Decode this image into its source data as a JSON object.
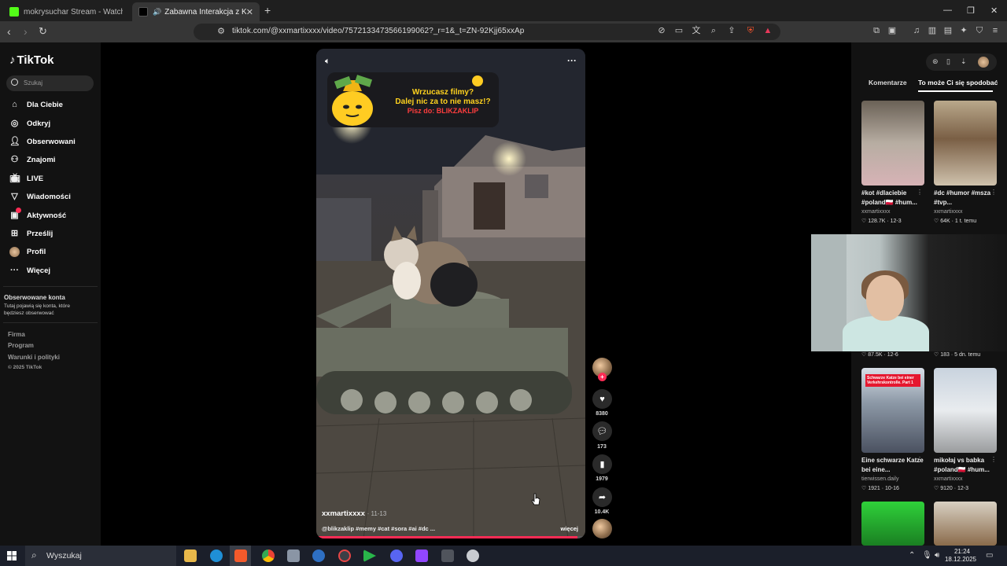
{
  "browser": {
    "tabs": [
      {
        "label": "mokrysuchar Stream - Watch Live on",
        "favicon_color": "#53fc18"
      },
      {
        "label": "Zabawna Interakcja z Kotem w",
        "favicon_color": "#000000"
      }
    ],
    "new_tab": "+",
    "url": "tiktok.com/@xxmartixxxx/video/7572133473566199062?_r=1&_t=ZN-92Kjj65xxAp"
  },
  "sidebar": {
    "logo": "TikTok",
    "search_placeholder": "Szukaj",
    "nav": [
      {
        "label": "Dla Ciebie",
        "icon": "home-icon"
      },
      {
        "label": "Odkryj",
        "icon": "compass-icon"
      },
      {
        "label": "Obserwowani",
        "icon": "following-icon"
      },
      {
        "label": "Znajomi",
        "icon": "friends-icon"
      },
      {
        "label": "LIVE",
        "icon": "live-icon"
      },
      {
        "label": "Wiadomości",
        "icon": "messages-icon"
      },
      {
        "label": "Aktywność",
        "icon": "activity-icon"
      },
      {
        "label": "Prześlij",
        "icon": "upload-icon"
      },
      {
        "label": "Profil",
        "icon": "profile-avatar"
      },
      {
        "label": "Więcej",
        "icon": "more-icon"
      }
    ],
    "following_heading": "Obserwowane konta",
    "following_text": "Tutaj pojawią się konta, które będziesz obserwować",
    "footer": [
      "Firma",
      "Program",
      "Warunki i polityki",
      "© 2025 TikTok"
    ]
  },
  "video": {
    "banner": {
      "line1": "Wrzucasz filmy?",
      "line2": "Dalej nic za to nie masz!?",
      "line3": "Pisz do: BLIKZAKLIP"
    },
    "author": "xxmartixxxx",
    "date": "· 11-13",
    "caption": "@blikzaklip #memy #cat #sora #ai #dc ...",
    "more": "więcej",
    "progress": 0.97
  },
  "actions": {
    "likes": "8380",
    "comments": "173",
    "saves": "1979",
    "shares": "10.4K"
  },
  "right_panel": {
    "tabs": [
      "Komentarze",
      "To może Ci się spodobać"
    ],
    "items": [
      {
        "title": "#kot #dlaciebie #poland🇵🇱 #hum...",
        "user": "xxmartixxxx",
        "stats": "♡ 128.7K · 12-3"
      },
      {
        "title": "#dc #humor #msza #tvp...",
        "user": "xxmartixxxx",
        "stats": "♡ 64K · 1 t. temu"
      },
      {
        "stats": "♡ 87.5K · 12-6"
      },
      {
        "stats": "♡ 183 · 5 dn. temu"
      },
      {
        "title": "Eine schwarze Katze bei eine...",
        "user": "tierwissen.daily",
        "stats": "♡ 1921 · 10-16",
        "overlay": "Schwarze Katze bei einer Verkehrskontrolle. Part 1"
      },
      {
        "title": "mikołaj vs babka #poland🇵🇱 #hum...",
        "user": "xxmartixxxx",
        "stats": "♡ 9120 · 12-3"
      }
    ]
  },
  "taskbar": {
    "search": "Wyszukaj",
    "time": "21:24",
    "date": "18.12.2025"
  }
}
